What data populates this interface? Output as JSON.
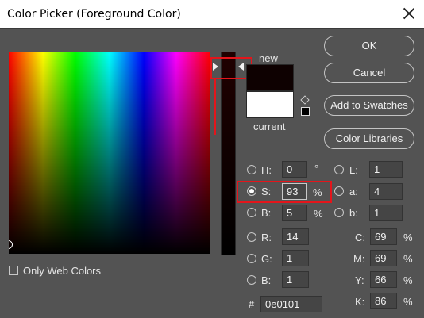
{
  "dialog": {
    "title": "Color Picker (Foreground Color)"
  },
  "preview": {
    "new_label": "new",
    "current_label": "current",
    "new_color": "#0e0101",
    "current_color": "#ffffff"
  },
  "buttons": {
    "ok": "OK",
    "cancel": "Cancel",
    "add_to_swatches": "Add to Swatches",
    "color_libraries": "Color Libraries"
  },
  "hsb": {
    "h": {
      "label": "H:",
      "value": "0",
      "unit": "°"
    },
    "s": {
      "label": "S:",
      "value": "93",
      "unit": "%",
      "selected": true
    },
    "b": {
      "label": "B:",
      "value": "5",
      "unit": "%"
    }
  },
  "lab": {
    "l": {
      "label": "L:",
      "value": "1"
    },
    "a": {
      "label": "a:",
      "value": "4"
    },
    "b": {
      "label": "b:",
      "value": "1"
    }
  },
  "rgb": {
    "r": {
      "label": "R:",
      "value": "14"
    },
    "g": {
      "label": "G:",
      "value": "1"
    },
    "b": {
      "label": "B:",
      "value": "1"
    }
  },
  "cmyk": {
    "c": {
      "label": "C:",
      "value": "69",
      "unit": "%"
    },
    "m": {
      "label": "M:",
      "value": "69",
      "unit": "%"
    },
    "y": {
      "label": "Y:",
      "value": "66",
      "unit": "%"
    },
    "k": {
      "label": "K:",
      "value": "86",
      "unit": "%"
    }
  },
  "hex": {
    "label": "#",
    "value": "0e0101"
  },
  "options": {
    "only_web_colors": "Only Web Colors"
  },
  "annotation_color": "#e4151b"
}
